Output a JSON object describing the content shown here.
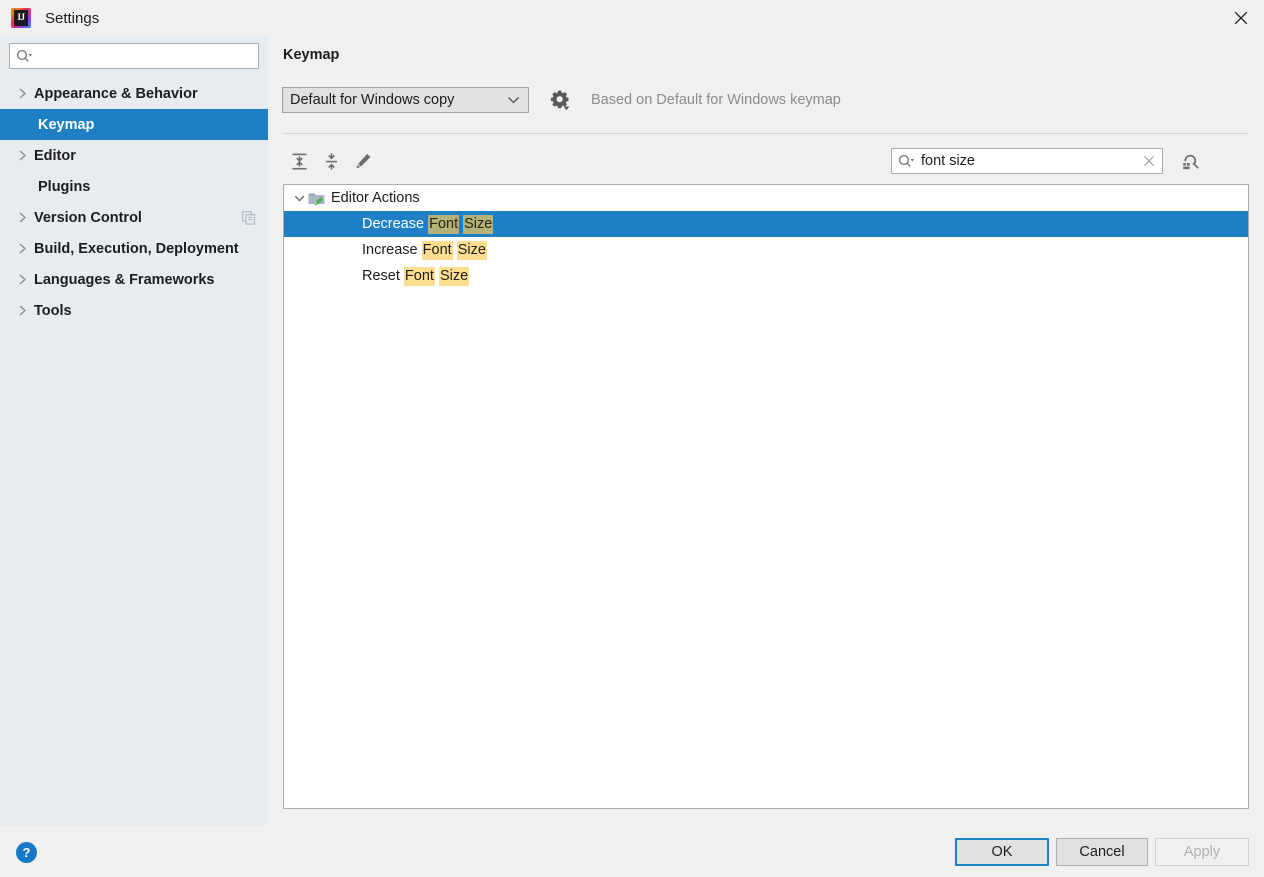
{
  "window": {
    "title": "Settings",
    "logo_icon": "intellij-idea-logo",
    "close_icon": "close-icon"
  },
  "sidebar": {
    "search": {
      "value": "",
      "placeholder": "",
      "icon": "search-dropdown-icon"
    },
    "items": [
      {
        "label": "Appearance & Behavior",
        "expandable": true,
        "selected": false,
        "badge_icon": null
      },
      {
        "label": "Keymap",
        "expandable": false,
        "selected": true,
        "badge_icon": null
      },
      {
        "label": "Editor",
        "expandable": true,
        "selected": false,
        "badge_icon": null
      },
      {
        "label": "Plugins",
        "expandable": false,
        "selected": false,
        "badge_icon": null
      },
      {
        "label": "Version Control",
        "expandable": true,
        "selected": false,
        "badge_icon": "copy-icon"
      },
      {
        "label": "Build, Execution, Deployment",
        "expandable": true,
        "selected": false,
        "badge_icon": null
      },
      {
        "label": "Languages & Frameworks",
        "expandable": true,
        "selected": false,
        "badge_icon": null
      },
      {
        "label": "Tools",
        "expandable": true,
        "selected": false,
        "badge_icon": null
      }
    ]
  },
  "main": {
    "title": "Keymap",
    "keymap_select": {
      "value": "Default for Windows copy",
      "arrow_icon": "chevron-down-icon"
    },
    "gear_icon": "gear-dropdown-icon",
    "based_on_text": "Based on Default for Windows keymap",
    "toolbar": {
      "expand_all_label": "Expand All",
      "expand_all_icon": "expand-all-icon",
      "collapse_all_label": "Collapse All",
      "collapse_all_icon": "collapse-all-icon",
      "edit_label": "Edit Shortcut",
      "edit_icon": "pencil-icon"
    },
    "search": {
      "value": "font size",
      "placeholder": "",
      "icon": "search-dropdown-icon",
      "clear_icon": "clear-x-icon"
    },
    "shortcut_search_icon": "find-by-shortcut-icon",
    "tree": [
      {
        "type": "group",
        "label": "Editor Actions",
        "icon": "edit-folder-icon",
        "chevron_icon": "chevron-down-icon",
        "expanded": true,
        "selected": false
      },
      {
        "type": "action",
        "selected": true,
        "parts": [
          {
            "text": "Decrease ",
            "highlight": false
          },
          {
            "text": "Font",
            "highlight": true
          },
          {
            "text": " ",
            "highlight": false
          },
          {
            "text": "Size",
            "highlight": true
          }
        ]
      },
      {
        "type": "action",
        "selected": false,
        "parts": [
          {
            "text": "Increase ",
            "highlight": false
          },
          {
            "text": "Font",
            "highlight": true
          },
          {
            "text": " ",
            "highlight": false
          },
          {
            "text": "Size",
            "highlight": true
          }
        ]
      },
      {
        "type": "action",
        "selected": false,
        "parts": [
          {
            "text": "Reset ",
            "highlight": false
          },
          {
            "text": "Font",
            "highlight": true
          },
          {
            "text": " ",
            "highlight": false
          },
          {
            "text": "Size",
            "highlight": true
          }
        ]
      }
    ]
  },
  "footer": {
    "help_label": "?",
    "ok_label": "OK",
    "cancel_label": "Cancel",
    "apply_label": "Apply",
    "apply_enabled": false
  },
  "colors": {
    "selection_blue": "#1e7fc4",
    "sidebar_bg": "#e7ecf1",
    "dialog_bg": "#f0f0f0",
    "highlight_yellow": "#ffdf8f",
    "highlight_on_selection": "#b5b277",
    "muted_text": "#8c8c8c",
    "help_blue": "#1878c8"
  }
}
